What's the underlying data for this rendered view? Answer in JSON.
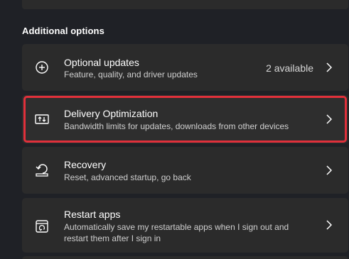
{
  "section": {
    "title": "Additional options"
  },
  "items": [
    {
      "title": "Optional updates",
      "description": "Feature, quality, and driver updates",
      "status": "2 available",
      "icon": "plus-circle-icon"
    },
    {
      "title": "Delivery Optimization",
      "description": "Bandwidth limits for updates, downloads from other devices",
      "icon": "delivery-optimization-icon"
    },
    {
      "title": "Recovery",
      "description": "Reset, advanced startup, go back",
      "icon": "recovery-icon"
    },
    {
      "title": "Restart apps",
      "description": "Automatically save my restartable apps when I sign out and restart them after I sign in",
      "icon": "restart-apps-icon"
    }
  ],
  "colors": {
    "background": "#1f2126",
    "card": "#2b2b2b",
    "highlight_outline": "#e0303b"
  }
}
